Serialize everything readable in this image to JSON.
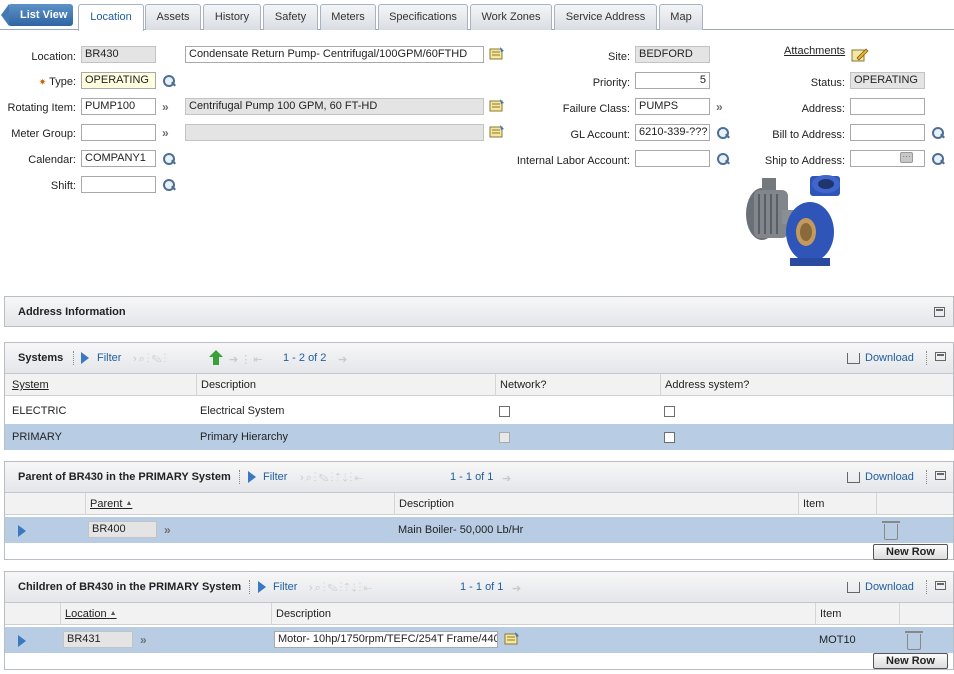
{
  "tabs": {
    "list_view": "List View",
    "items": [
      "Location",
      "Assets",
      "History",
      "Safety",
      "Meters",
      "Specifications",
      "Work Zones",
      "Service Address",
      "Map"
    ],
    "active": "Location"
  },
  "form": {
    "location_label": "Location:",
    "location_value": "BR430",
    "location_desc": "Condensate Return Pump- Centrifugal/100GPM/60FTHD",
    "type_label": "Type:",
    "type_required_mark": "✷",
    "type_value": "OPERATING",
    "rotating_label": "Rotating Item:",
    "rotating_value": "PUMP100",
    "rotating_desc": "Centrifugal Pump 100 GPM, 60 FT-HD",
    "meter_group_label": "Meter Group:",
    "meter_group_value": "",
    "meter_group_desc": "",
    "calendar_label": "Calendar:",
    "calendar_value": "COMPANY1",
    "shift_label": "Shift:",
    "shift_value": "",
    "site_label": "Site:",
    "site_value": "BEDFORD",
    "priority_label": "Priority:",
    "priority_value": "5",
    "failure_class_label": "Failure Class:",
    "failure_class_value": "PUMPS",
    "gl_account_label": "GL Account:",
    "gl_account_value": "6210-339-???",
    "internal_labor_label": "Internal Labor Account:",
    "internal_labor_value": "",
    "attachments_label": "Attachments",
    "status_label": "Status:",
    "status_value": "OPERATING",
    "address_label": "Address:",
    "address_value": "",
    "bill_to_label": "Bill to Address:",
    "bill_to_value": "",
    "ship_to_label": "Ship to Address:",
    "ship_to_value": ""
  },
  "address_section": {
    "title": "Address Information"
  },
  "systems": {
    "title": "Systems",
    "filter": "Filter",
    "count": "1 - 2 of 2",
    "download": "Download",
    "columns": [
      "System",
      "Description",
      "Network?",
      "Address system?"
    ],
    "rows": [
      {
        "system": "ELECTRIC",
        "description": "Electrical System",
        "network": false,
        "address_system": false
      },
      {
        "system": "PRIMARY",
        "description": "Primary Hierarchy",
        "network": false,
        "address_system": false
      }
    ]
  },
  "parent": {
    "title": "Parent of BR430 in the PRIMARY System",
    "filter": "Filter",
    "count": "1 - 1 of 1",
    "download": "Download",
    "columns": [
      "Parent",
      "Description",
      "Item"
    ],
    "rows": [
      {
        "parent": "BR400",
        "description": "Main Boiler- 50,000 Lb/Hr",
        "item": ""
      }
    ],
    "new_row": "New Row"
  },
  "children": {
    "title": "Children of BR430 in the PRIMARY System",
    "filter": "Filter",
    "count": "1 - 1 of 1",
    "download": "Download",
    "columns": [
      "Location",
      "Description",
      "Item"
    ],
    "rows": [
      {
        "location": "BR431",
        "description": "Motor- 10hp/1750rpm/TEFC/254T Frame/440",
        "item": "MOT10"
      }
    ],
    "new_row": "New Row"
  },
  "colors": {
    "accent": "#1f5e9e",
    "selected_row": "#b8cde4",
    "pump_blue": "#2f55b8"
  }
}
